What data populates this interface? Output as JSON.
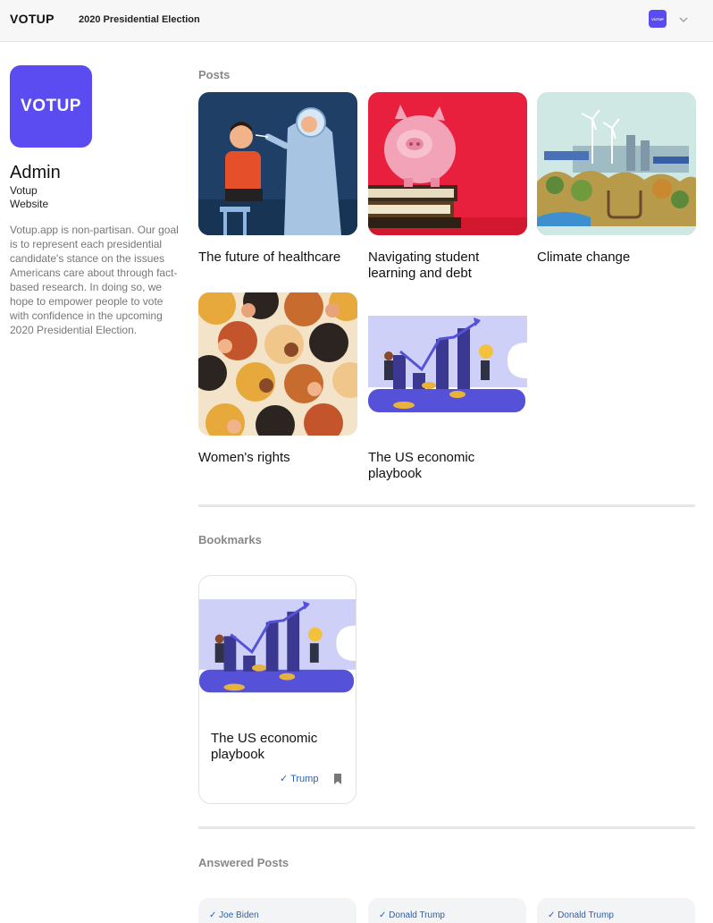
{
  "header": {
    "brand": "VOTUP",
    "title": "2020 Presidential Election",
    "avatar_text": "VOTUP"
  },
  "profile": {
    "logo_text": "VOTUP",
    "name": "Admin",
    "org": "Votup",
    "website": "Website",
    "bio": "Votup.app is non-partisan. Our goal is to represent each presidential candidate's stance on the issues Americans care about through fact-based research. In doing so, we hope to empower people to vote with confidence in the upcoming 2020 Presidential Election."
  },
  "sections": {
    "posts": "Posts",
    "bookmarks": "Bookmarks",
    "answered": "Answered Posts"
  },
  "posts": [
    {
      "title": "The future of healthcare",
      "image": "healthcare-illustration"
    },
    {
      "title": "Navigating student learning and debt",
      "image": "piggy-bank-photo"
    },
    {
      "title": "Climate change",
      "image": "climate-illustration"
    },
    {
      "title": "Women's rights",
      "image": "women-illustration"
    },
    {
      "title": "The US economic playbook",
      "image": "economy-illustration"
    }
  ],
  "bookmarks": [
    {
      "title": "The US economic playbook",
      "tag": "✓ Trump",
      "icon": "bookmark-icon"
    }
  ],
  "answered": [
    {
      "label": "✓ Joe Biden"
    },
    {
      "label": "✓ Donald Trump"
    },
    {
      "label": "✓ Donald Trump"
    }
  ],
  "colors": {
    "accent": "#5a4cf0",
    "link": "#2b5fb0"
  }
}
